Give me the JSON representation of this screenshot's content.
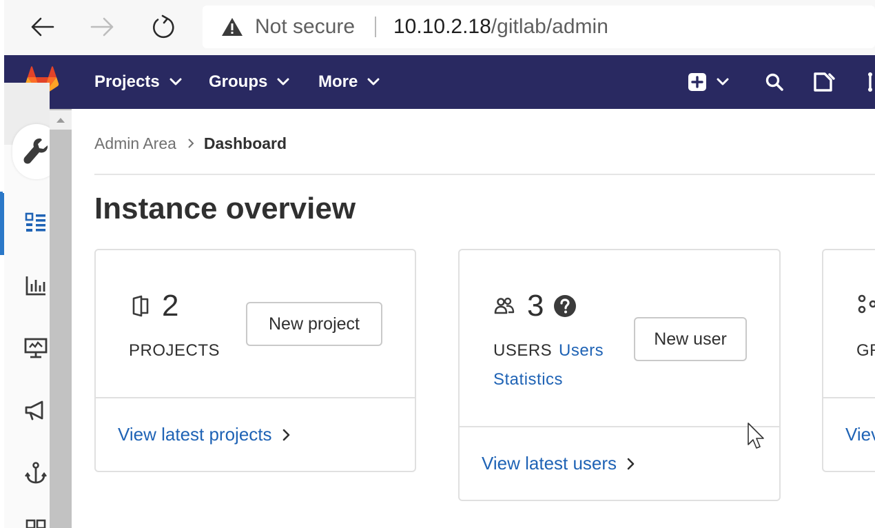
{
  "browser": {
    "security_label": "Not secure",
    "url_host": "10.10.2.18",
    "url_path": "/gitlab/admin",
    "icons": [
      "back-arrow-icon",
      "forward-arrow-icon",
      "reload-icon",
      "warning-icon"
    ]
  },
  "topnav": {
    "items": [
      {
        "label": "Projects"
      },
      {
        "label": "Groups"
      },
      {
        "label": "More"
      }
    ],
    "icons": [
      "gitlab-logo",
      "plus-square-icon",
      "search-icon",
      "issues-icon"
    ],
    "background": "#292961"
  },
  "sidebar": {
    "icons": [
      "wrench-icon",
      "dashboard-icon",
      "analytics-icon",
      "monitoring-icon",
      "megaphone-icon",
      "anchor-icon"
    ]
  },
  "breadcrumb": {
    "parent": "Admin Area",
    "current": "Dashboard"
  },
  "page": {
    "title": "Instance overview"
  },
  "cards": {
    "projects": {
      "count": "2",
      "label": "PROJECTS",
      "button": "New project",
      "footer_link": "View latest projects"
    },
    "users": {
      "count": "3",
      "label": "USERS",
      "stats_link": "Users Statistics",
      "button": "New user",
      "footer_link": "View latest users"
    },
    "groups": {
      "label": "GR",
      "footer_link": "Viev"
    }
  },
  "colors": {
    "link": "#1f63b5",
    "nav": "#292961",
    "accent": "#2b78c8"
  }
}
